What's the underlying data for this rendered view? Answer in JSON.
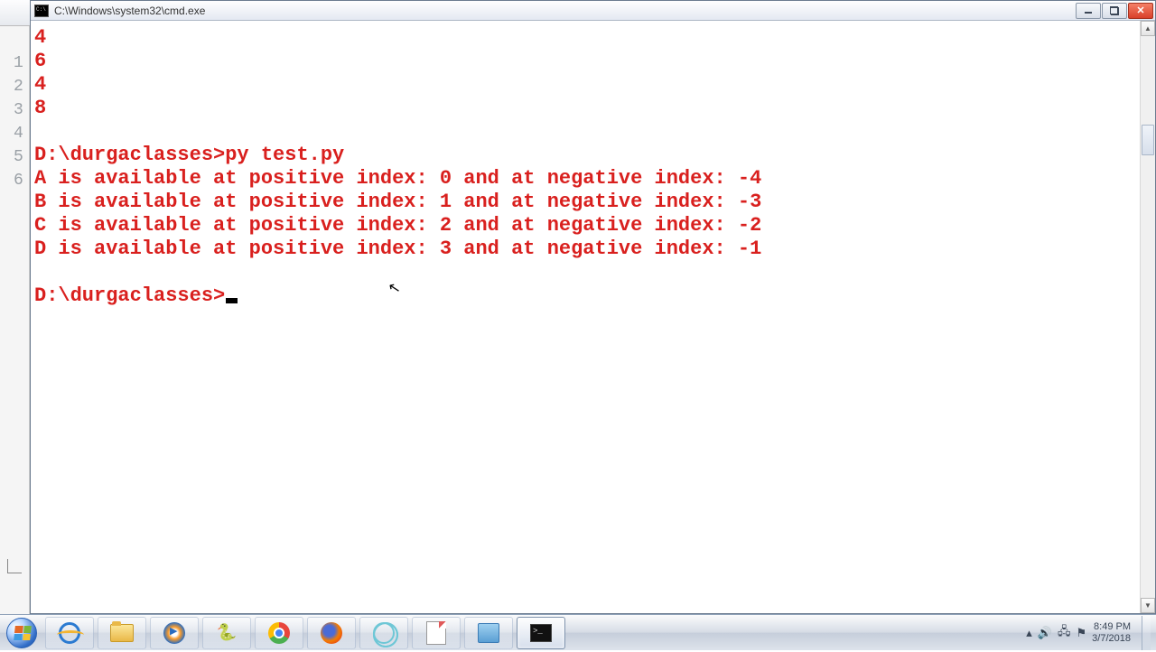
{
  "window": {
    "title": "C:\\Windows\\system32\\cmd.exe"
  },
  "bg_linenos": [
    "1",
    "2",
    "3",
    "4",
    "5",
    "6"
  ],
  "terminal": {
    "prev_output": [
      "4",
      "6",
      "4",
      "8"
    ],
    "blank1": "",
    "cmd_line": "D:\\durgaclasses>py test.py",
    "out1": "A is available at positive index: 0 and at negative index: -4",
    "out2": "B is available at positive index: 1 and at negative index: -3",
    "out3": "C is available at positive index: 2 and at negative index: -2",
    "out4": "D is available at positive index: 3 and at negative index: -1",
    "blank2": "",
    "prompt": "D:\\durgaclasses>"
  },
  "taskbar_icons": [
    "ie",
    "folder",
    "wmp",
    "py",
    "chrome",
    "ff",
    "atom",
    "note",
    "edit",
    "cmd"
  ],
  "tray": {
    "time": "8:49 PM",
    "date": "3/7/2018"
  }
}
